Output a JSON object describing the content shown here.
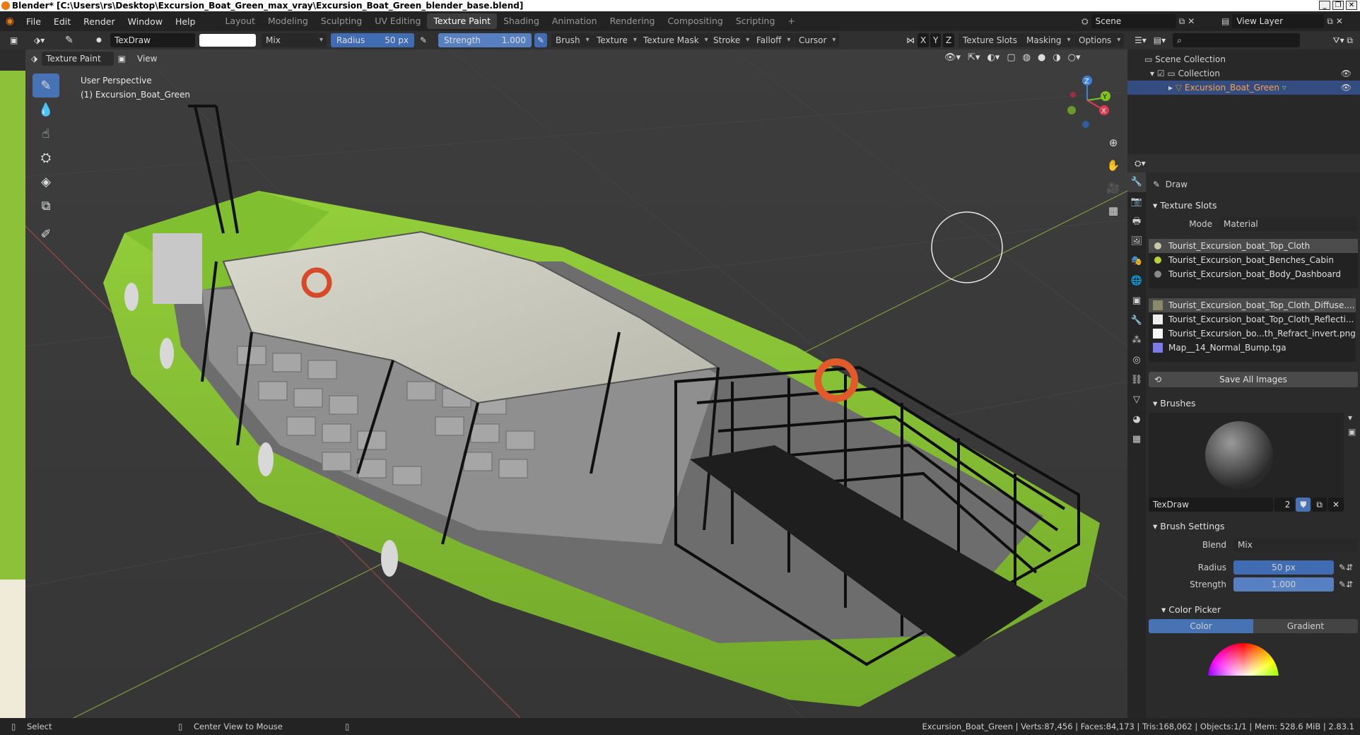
{
  "window": {
    "title": "Blender* [C:\\Users\\rs\\Desktop\\Excursion_Boat_Green_max_vray\\Excursion_Boat_Green_blender_base.blend]",
    "controls": [
      "_",
      "❐",
      "✕"
    ]
  },
  "menu": [
    "File",
    "Edit",
    "Render",
    "Window",
    "Help"
  ],
  "workspaces": [
    "Layout",
    "Modeling",
    "Sculpting",
    "UV Editing",
    "Texture Paint",
    "Shading",
    "Animation",
    "Rendering",
    "Compositing",
    "Scripting",
    "+"
  ],
  "active_workspace": "Texture Paint",
  "scene": {
    "name": "Scene",
    "view_layer": "View Layer"
  },
  "header": {
    "brush_name": "TexDraw",
    "blend": "Mix",
    "radius_label": "Radius",
    "radius_value": "50 px",
    "strength_label": "Strength",
    "strength_value": "1.000",
    "strength_fill": 1.0,
    "menus": [
      "Brush",
      "Texture",
      "Texture Mask",
      "Stroke",
      "Falloff",
      "Cursor"
    ],
    "axes": [
      "X",
      "Y",
      "Z"
    ],
    "right_menus": [
      "Texture Slots",
      "Masking",
      "Options"
    ]
  },
  "header2": {
    "mode": "Texture Paint",
    "view": "View"
  },
  "viewport": {
    "perspective": "User Perspective",
    "object": "(1) Excursion_Boat_Green",
    "gizmo": {
      "z": "Z",
      "y": "Y",
      "x": "X"
    }
  },
  "outliner": {
    "scene_collection": "Scene Collection",
    "collection": "Collection",
    "object": "Excursion_Boat_Green"
  },
  "properties": {
    "tool_name": "Draw",
    "texture_slots": {
      "title": "Texture Slots",
      "mode_label": "Mode",
      "mode_value": "Material",
      "materials": [
        {
          "name": "Tourist_Excursion_boat_Top_Cloth",
          "color": "#c8c8a8",
          "selected": true
        },
        {
          "name": "Tourist_Excursion_boat_Benches_Cabin",
          "color": "#b8d33a",
          "selected": false
        },
        {
          "name": "Tourist_Excursion_boat_Body_Dashboard",
          "color": "#8a8a8a",
          "selected": false
        }
      ],
      "images": [
        {
          "name": "Tourist_Excursion_boat_Top_Cloth_Diffuse....",
          "selected": true
        },
        {
          "name": "Tourist_Excursion_boat_Top_Cloth_Reflecti...",
          "selected": false
        },
        {
          "name": "Tourist_Excursion_bo...th_Refract_invert.png",
          "selected": false
        },
        {
          "name": "Map__14_Normal_Bump.tga",
          "selected": false
        }
      ],
      "save_button": "Save All Images"
    },
    "brushes": {
      "title": "Brushes",
      "name": "TexDraw",
      "users": "2"
    },
    "brush_settings": {
      "title": "Brush Settings",
      "blend_label": "Blend",
      "blend_value": "Mix",
      "radius_label": "Radius",
      "radius_value": "50 px",
      "strength_label": "Strength",
      "strength_value": "1.000"
    },
    "color_picker": {
      "title": "Color Picker",
      "tab_color": "Color",
      "tab_gradient": "Gradient"
    }
  },
  "status": {
    "select": "Select",
    "center": "Center View to Mouse",
    "stats": "Excursion_Boat_Green | Verts:87,456 | Faces:84,173 | Tris:168,062 | Objects:1/1 | Mem: 528.6 MiB | 2.83.1"
  },
  "colors": {
    "accent": "#4772b3",
    "hull_green": "#8cc93a",
    "canopy": "#cfcfc0",
    "axis_x": "#e03a4e",
    "axis_y": "#7ec41c",
    "axis_z": "#3b82e0"
  }
}
